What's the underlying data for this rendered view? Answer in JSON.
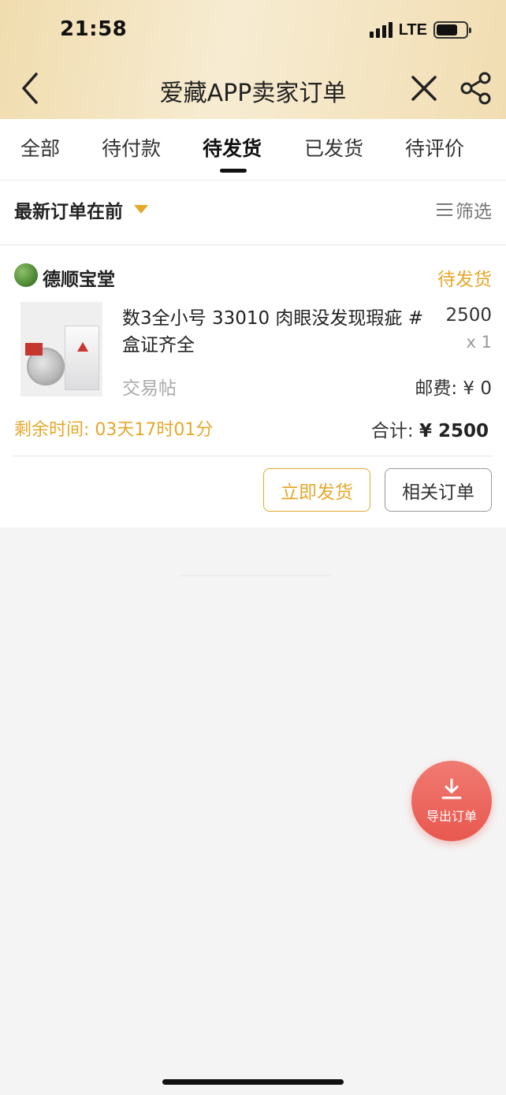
{
  "status_bar": {
    "time": "21:58",
    "network": "LTE"
  },
  "nav": {
    "title": "爱藏APP卖家订单"
  },
  "tabs": [
    {
      "label": "全部"
    },
    {
      "label": "待付款"
    },
    {
      "label": "待发货",
      "active": true
    },
    {
      "label": "已发货"
    },
    {
      "label": "待评价"
    }
  ],
  "sort": {
    "label": "最新订单在前",
    "filter_label": "筛选"
  },
  "order": {
    "shop_name": "德顺宝堂",
    "status": "待发货",
    "product_title": "数3全小号 33010 肉眼没发现瑕疵 #盒证齐全",
    "price": "2500",
    "quantity": "x 1",
    "category": "交易帖",
    "shipping": "邮费: ¥ 0",
    "remaining_time": "剩余时间: 03天17时01分",
    "total_label": "合计: ",
    "total_value": "¥ 2500",
    "buttons": {
      "ship_now": "立即发货",
      "related_orders": "相关订单"
    }
  },
  "fab": {
    "label": "导出订单",
    "icon": "download-icon"
  },
  "colors": {
    "accent": "#e5a82b",
    "fab": "#e8584f",
    "header_bg": "#f3e4c2"
  }
}
